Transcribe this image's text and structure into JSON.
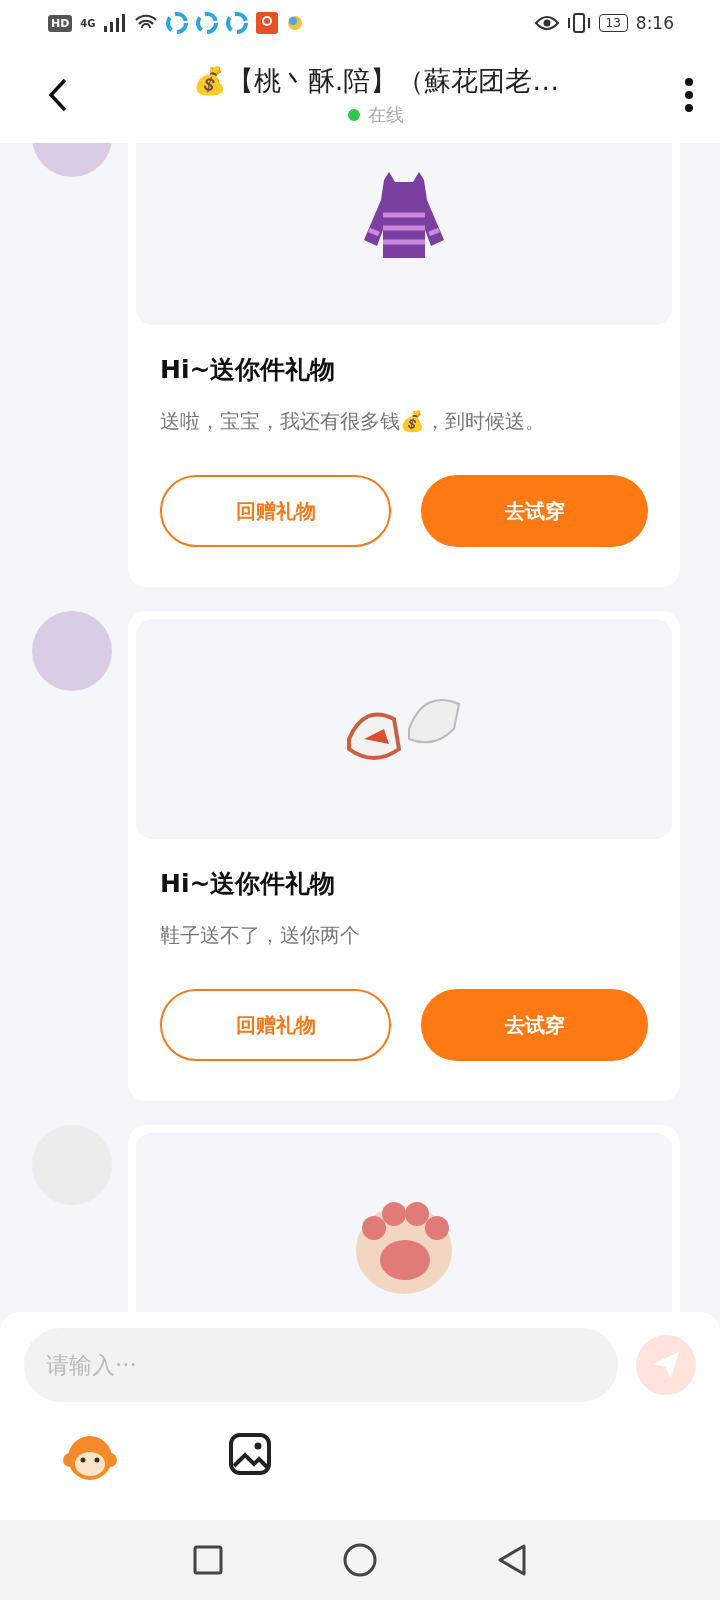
{
  "status_bar": {
    "hd": "HD",
    "network": "4G",
    "battery": "13",
    "time": "8:16"
  },
  "header": {
    "title": "💰【桃丶酥.陪】（蘇花团老…",
    "status": "在线",
    "online": true
  },
  "messages": [
    {
      "kind": "photo",
      "title": "Hi~送你件礼物",
      "text": "送啦，宝宝，我还有很多钱💰，到时候送。",
      "buttons": [
        {
          "label": "回赠礼物",
          "kind": "outline"
        },
        {
          "label": "去试穿",
          "kind": "filled"
        }
      ]
    },
    {
      "kind": "photo",
      "title": "Hi~送你件礼物",
      "text": "鞋子送不了，送你两个",
      "buttons": [
        {
          "label": "回赠礼物",
          "kind": "outline"
        },
        {
          "label": "去试穿",
          "kind": "filled"
        }
      ]
    },
    {
      "kind": "empty"
    }
  ],
  "input": {
    "placeholder": "请输入···",
    "send_disabled": true
  }
}
